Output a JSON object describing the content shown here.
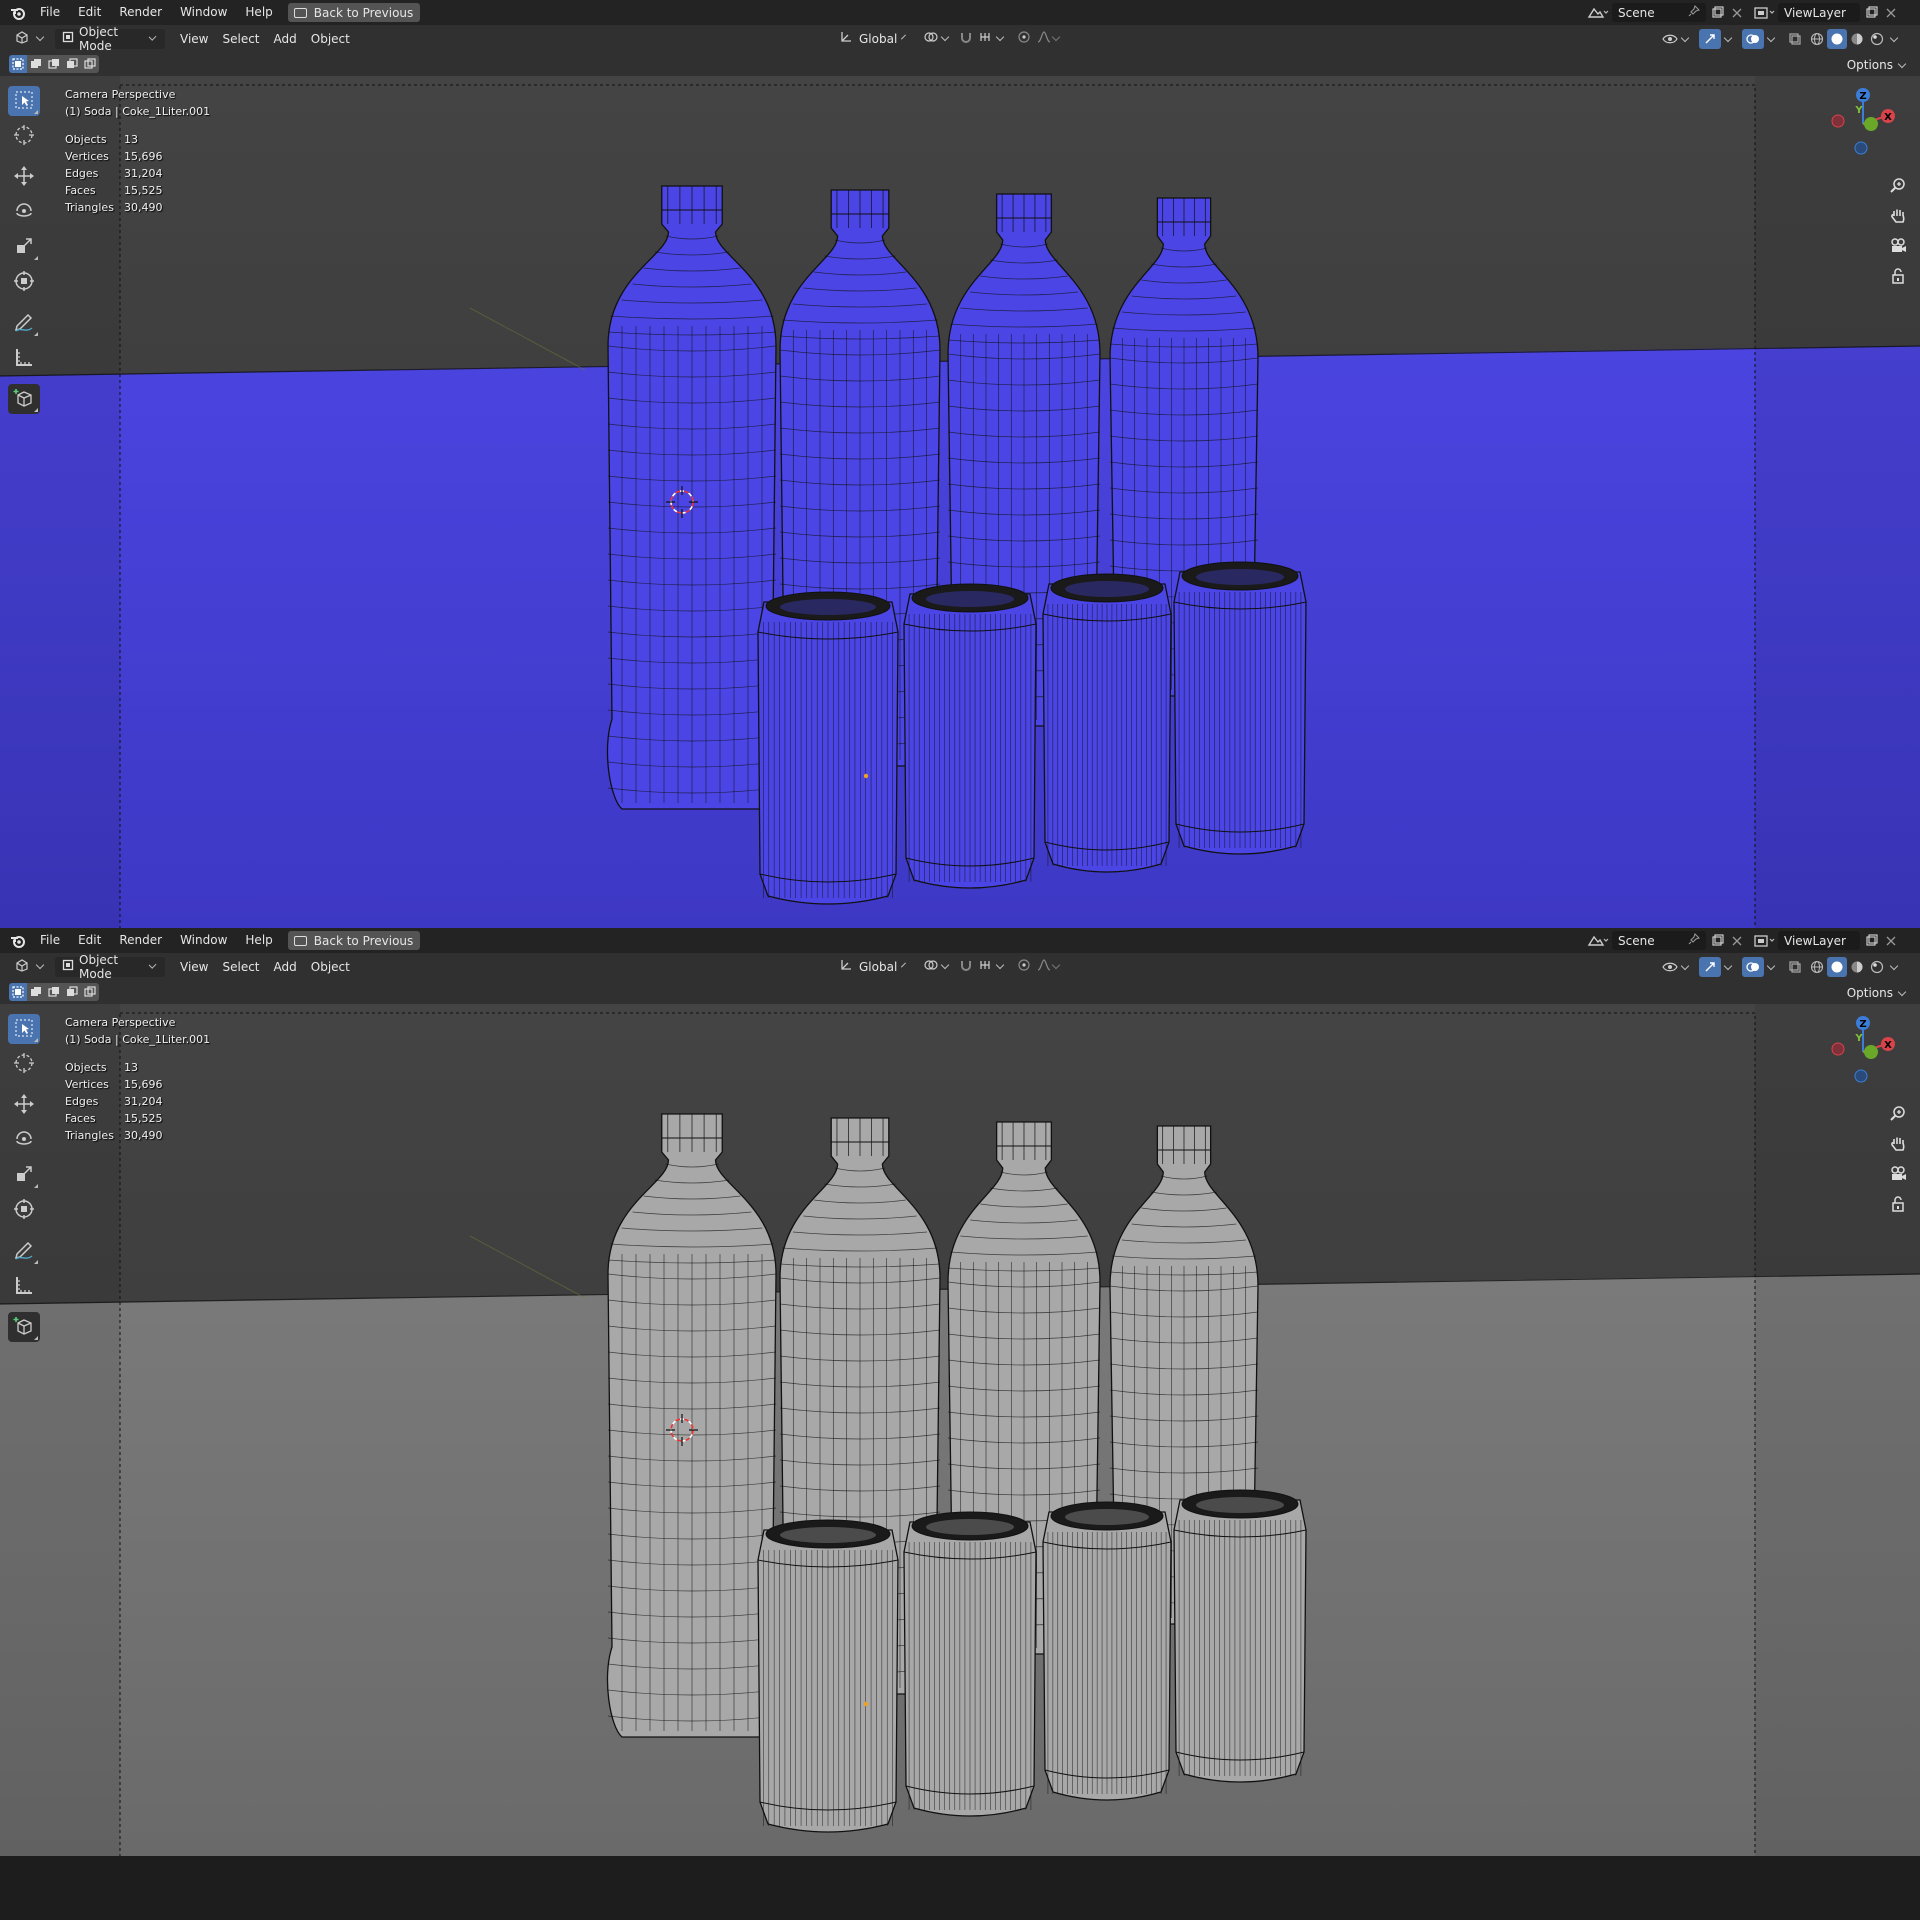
{
  "panes": [
    {
      "id": "top",
      "menu": {
        "items": [
          "File",
          "Edit",
          "Render",
          "Window",
          "Help"
        ],
        "back_button": "Back to Previous"
      },
      "scene": {
        "name": "Scene"
      },
      "view_layer": {
        "name": "ViewLayer"
      },
      "header": {
        "mode": "Object Mode",
        "menus": [
          "View",
          "Select",
          "Add",
          "Object"
        ],
        "transform_orientation": "Global",
        "options_label": "Options"
      },
      "viewport": {
        "title": "Camera Perspective",
        "active_object": "(1) Soda | Coke_1Liter.001",
        "stats": [
          {
            "label": "Objects",
            "value": "13"
          },
          {
            "label": "Vertices",
            "value": "15,696"
          },
          {
            "label": "Edges",
            "value": "31,204"
          },
          {
            "label": "Faces",
            "value": "15,525"
          },
          {
            "label": "Triangles",
            "value": "30,490"
          }
        ],
        "axes": {
          "x": "X",
          "y": "Y",
          "z": "Z"
        }
      },
      "colors": {
        "object": "#4a45e4",
        "floor": "#4b44e0",
        "floor_dark": "#3d38c4",
        "bg": "#3f3f3f"
      }
    },
    {
      "id": "bottom",
      "menu": {
        "items": [
          "File",
          "Edit",
          "Render",
          "Window",
          "Help"
        ],
        "back_button": "Back to Previous"
      },
      "scene": {
        "name": "Scene"
      },
      "view_layer": {
        "name": "ViewLayer"
      },
      "header": {
        "mode": "Object Mode",
        "menus": [
          "View",
          "Select",
          "Add",
          "Object"
        ],
        "transform_orientation": "Global",
        "options_label": "Options"
      },
      "viewport": {
        "title": "Camera Perspective",
        "active_object": "(1) Soda | Coke_1Liter.001",
        "stats": [
          {
            "label": "Objects",
            "value": "13"
          },
          {
            "label": "Vertices",
            "value": "15,696"
          },
          {
            "label": "Edges",
            "value": "31,204"
          },
          {
            "label": "Faces",
            "value": "15,525"
          },
          {
            "label": "Triangles",
            "value": "30,490"
          }
        ],
        "axes": {
          "x": "X",
          "y": "Y",
          "z": "Z"
        }
      },
      "colors": {
        "object": "#a8a8a8",
        "floor": "#7a7a7a",
        "floor_dark": "#6a6a6a",
        "bg": "#3f3f3f"
      }
    }
  ]
}
